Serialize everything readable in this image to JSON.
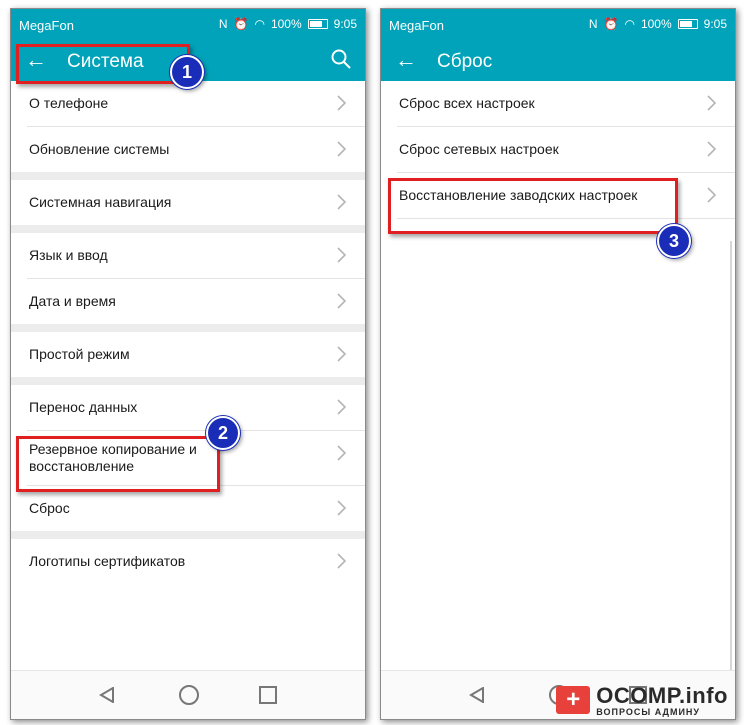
{
  "left": {
    "status": {
      "carrier": "MegaFon",
      "nfc": "N",
      "battery": "100%",
      "time": "9:05"
    },
    "title": "Система",
    "groups": [
      [
        {
          "label": "О телефоне"
        },
        {
          "label": "Обновление системы"
        }
      ],
      [
        {
          "label": "Системная навигация"
        }
      ],
      [
        {
          "label": "Язык и ввод"
        },
        {
          "label": "Дата и время"
        }
      ],
      [
        {
          "label": "Простой режим"
        }
      ],
      [
        {
          "label": "Перенос данных"
        },
        {
          "label": "Резервное копирование и восстановление"
        },
        {
          "label": "Сброс"
        }
      ],
      [
        {
          "label": "Логотипы сертификатов"
        }
      ]
    ]
  },
  "right": {
    "status": {
      "carrier": "MegaFon",
      "nfc": "N",
      "battery": "100%",
      "time": "9:05"
    },
    "title": "Сброс",
    "items": [
      {
        "label": "Сброс всех настроек"
      },
      {
        "label": "Сброс сетевых настроек"
      },
      {
        "label": "Восстановление заводских настроек"
      }
    ]
  },
  "annotations": {
    "badge1": "1",
    "badge2": "2",
    "badge3": "3",
    "highlight_color": "#e02020",
    "badge_color": "#1a2db8"
  },
  "watermark": {
    "logo": "+",
    "main": "OCOMP.info",
    "sub": "ВОПРОСЫ АДМИНУ"
  },
  "theme": {
    "accent": "#00a3b9"
  }
}
